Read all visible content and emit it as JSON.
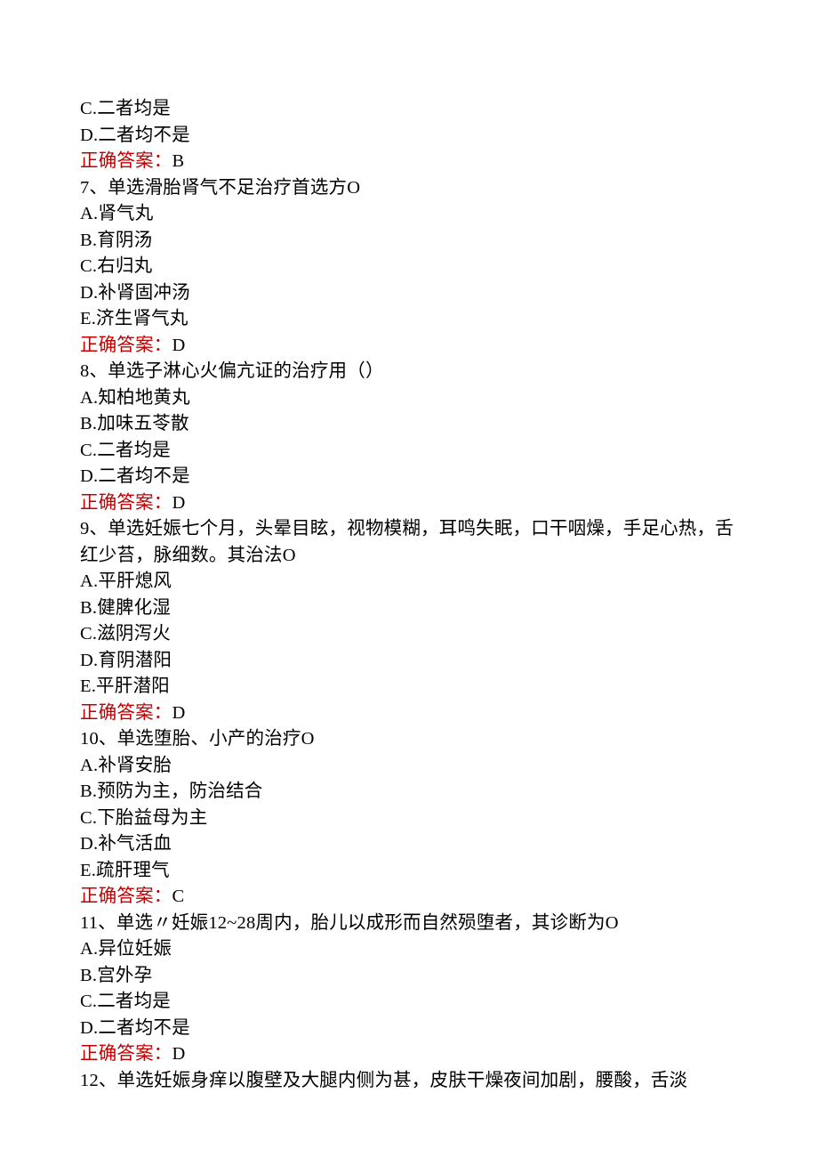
{
  "answerLabel": "正确答案：",
  "items": [
    {
      "kind": "opt",
      "text": "C.二者均是"
    },
    {
      "kind": "opt",
      "text": "D.二者均不是"
    },
    {
      "kind": "ans",
      "text": "B"
    },
    {
      "kind": "q",
      "text": "7、单选滑胎肾气不足治疗首选方O"
    },
    {
      "kind": "opt",
      "text": "A.肾气丸"
    },
    {
      "kind": "opt",
      "text": "B.育阴汤"
    },
    {
      "kind": "opt",
      "text": "C.右归丸"
    },
    {
      "kind": "opt",
      "text": "D.补肾固冲汤"
    },
    {
      "kind": "opt",
      "text": "E.济生肾气丸"
    },
    {
      "kind": "ans",
      "text": "D"
    },
    {
      "kind": "q",
      "text": "8、单选子淋心火偏亢证的治疗用（）"
    },
    {
      "kind": "opt",
      "text": "A.知柏地黄丸"
    },
    {
      "kind": "opt",
      "text": "B.加味五苓散"
    },
    {
      "kind": "opt",
      "text": "C.二者均是"
    },
    {
      "kind": "opt",
      "text": "D.二者均不是"
    },
    {
      "kind": "ans",
      "text": "D"
    },
    {
      "kind": "q",
      "text": "9、单选妊娠七个月，头晕目眩，视物模糊，耳鸣失眠，口干咽燥，手足心热，舌红少苔，脉细数。其治法O"
    },
    {
      "kind": "opt",
      "text": "A.平肝熄风"
    },
    {
      "kind": "opt",
      "text": "B.健脾化湿"
    },
    {
      "kind": "opt",
      "text": "C.滋阴泻火"
    },
    {
      "kind": "opt",
      "text": "D.育阴潜阳"
    },
    {
      "kind": "opt",
      "text": "E.平肝潜阳"
    },
    {
      "kind": "ans",
      "text": "D"
    },
    {
      "kind": "q",
      "text": "10、单选堕胎、小产的治疗O"
    },
    {
      "kind": "opt",
      "text": "A.补肾安胎"
    },
    {
      "kind": "opt",
      "text": "B.预防为主，防治结合"
    },
    {
      "kind": "opt",
      "text": "C.下胎益母为主"
    },
    {
      "kind": "opt",
      "text": "D.补气活血"
    },
    {
      "kind": "opt",
      "text": "E.疏肝理气"
    },
    {
      "kind": "ans",
      "text": "C"
    },
    {
      "kind": "q",
      "text": "11、单选〃妊娠12~28周内，胎儿以成形而自然殒堕者，其诊断为O"
    },
    {
      "kind": "opt",
      "text": "A.异位妊娠"
    },
    {
      "kind": "opt",
      "text": "B.宫外孕"
    },
    {
      "kind": "opt",
      "text": "C.二者均是"
    },
    {
      "kind": "opt",
      "text": "D.二者均不是"
    },
    {
      "kind": "ans",
      "text": "D"
    },
    {
      "kind": "q",
      "text": "12、单选妊娠身痒以腹壁及大腿内侧为甚，皮肤干燥夜间加剧，腰酸，舌淡"
    }
  ]
}
